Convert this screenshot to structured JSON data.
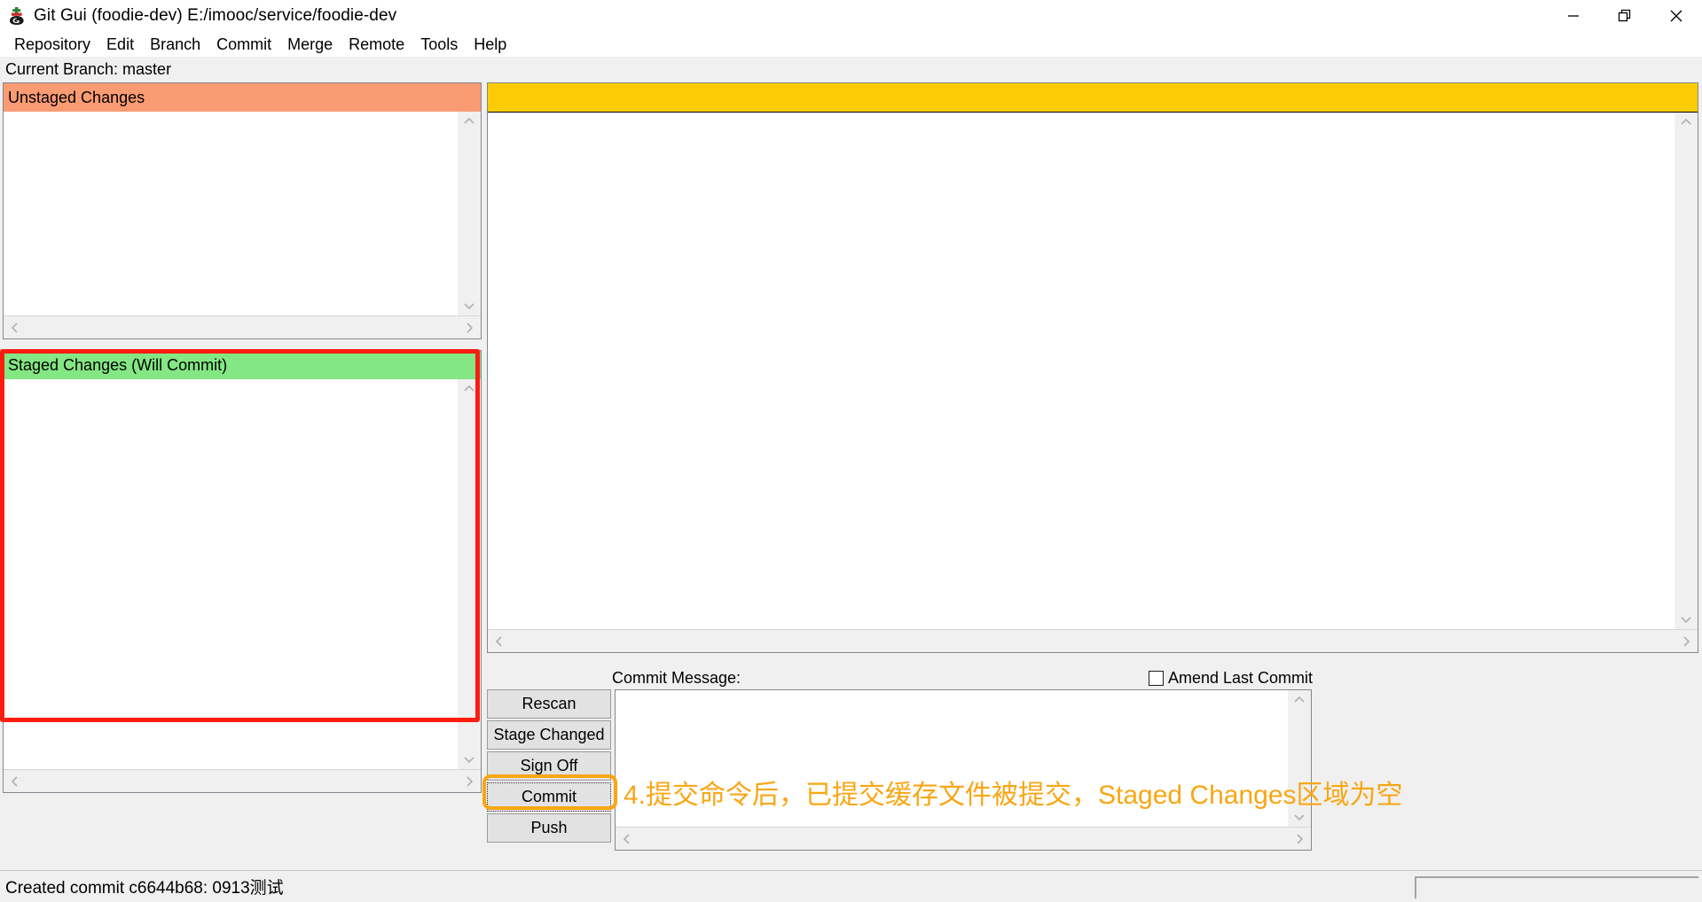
{
  "window": {
    "title": "Git Gui (foodie-dev) E:/imooc/service/foodie-dev",
    "icon": "git-gui-icon",
    "controls": {
      "minimize": "minimize-icon",
      "maximize": "restore-icon",
      "close": "close-icon"
    }
  },
  "menubar": {
    "items": [
      {
        "label": "Repository"
      },
      {
        "label": "Edit"
      },
      {
        "label": "Branch"
      },
      {
        "label": "Commit"
      },
      {
        "label": "Merge"
      },
      {
        "label": "Remote"
      },
      {
        "label": "Tools"
      },
      {
        "label": "Help"
      }
    ]
  },
  "branch_bar": {
    "text": "Current Branch: master"
  },
  "panels": {
    "unstaged": {
      "header": "Unstaged Changes",
      "header_color": "#fa9b74",
      "items": []
    },
    "staged": {
      "header": "Staged Changes (Will Commit)",
      "header_color": "#83e783",
      "items": [],
      "highlight_color": "#fc1c10"
    }
  },
  "diff_view": {
    "header_color": "#fbcc05",
    "content": ""
  },
  "commit": {
    "message_label": "Commit Message:",
    "amend_label": "Amend Last Commit",
    "amend_checked": false,
    "message_value": "",
    "buttons": [
      {
        "label": "Rescan",
        "name": "rescan-button",
        "focused": false
      },
      {
        "label": "Stage Changed",
        "name": "stage-changed-button",
        "focused": false
      },
      {
        "label": "Sign Off",
        "name": "sign-off-button",
        "focused": false
      },
      {
        "label": "Commit",
        "name": "commit-button",
        "focused": true
      },
      {
        "label": "Push",
        "name": "push-button",
        "focused": false
      }
    ],
    "focus_ring_color": "#f9a613"
  },
  "annotation": {
    "text": "4.提交命令后，已提交缓存文件被提交，Staged Changes区域为空",
    "color": "#f9a613"
  },
  "statusbar": {
    "text": "Created commit c6644b68: 0913测试"
  }
}
